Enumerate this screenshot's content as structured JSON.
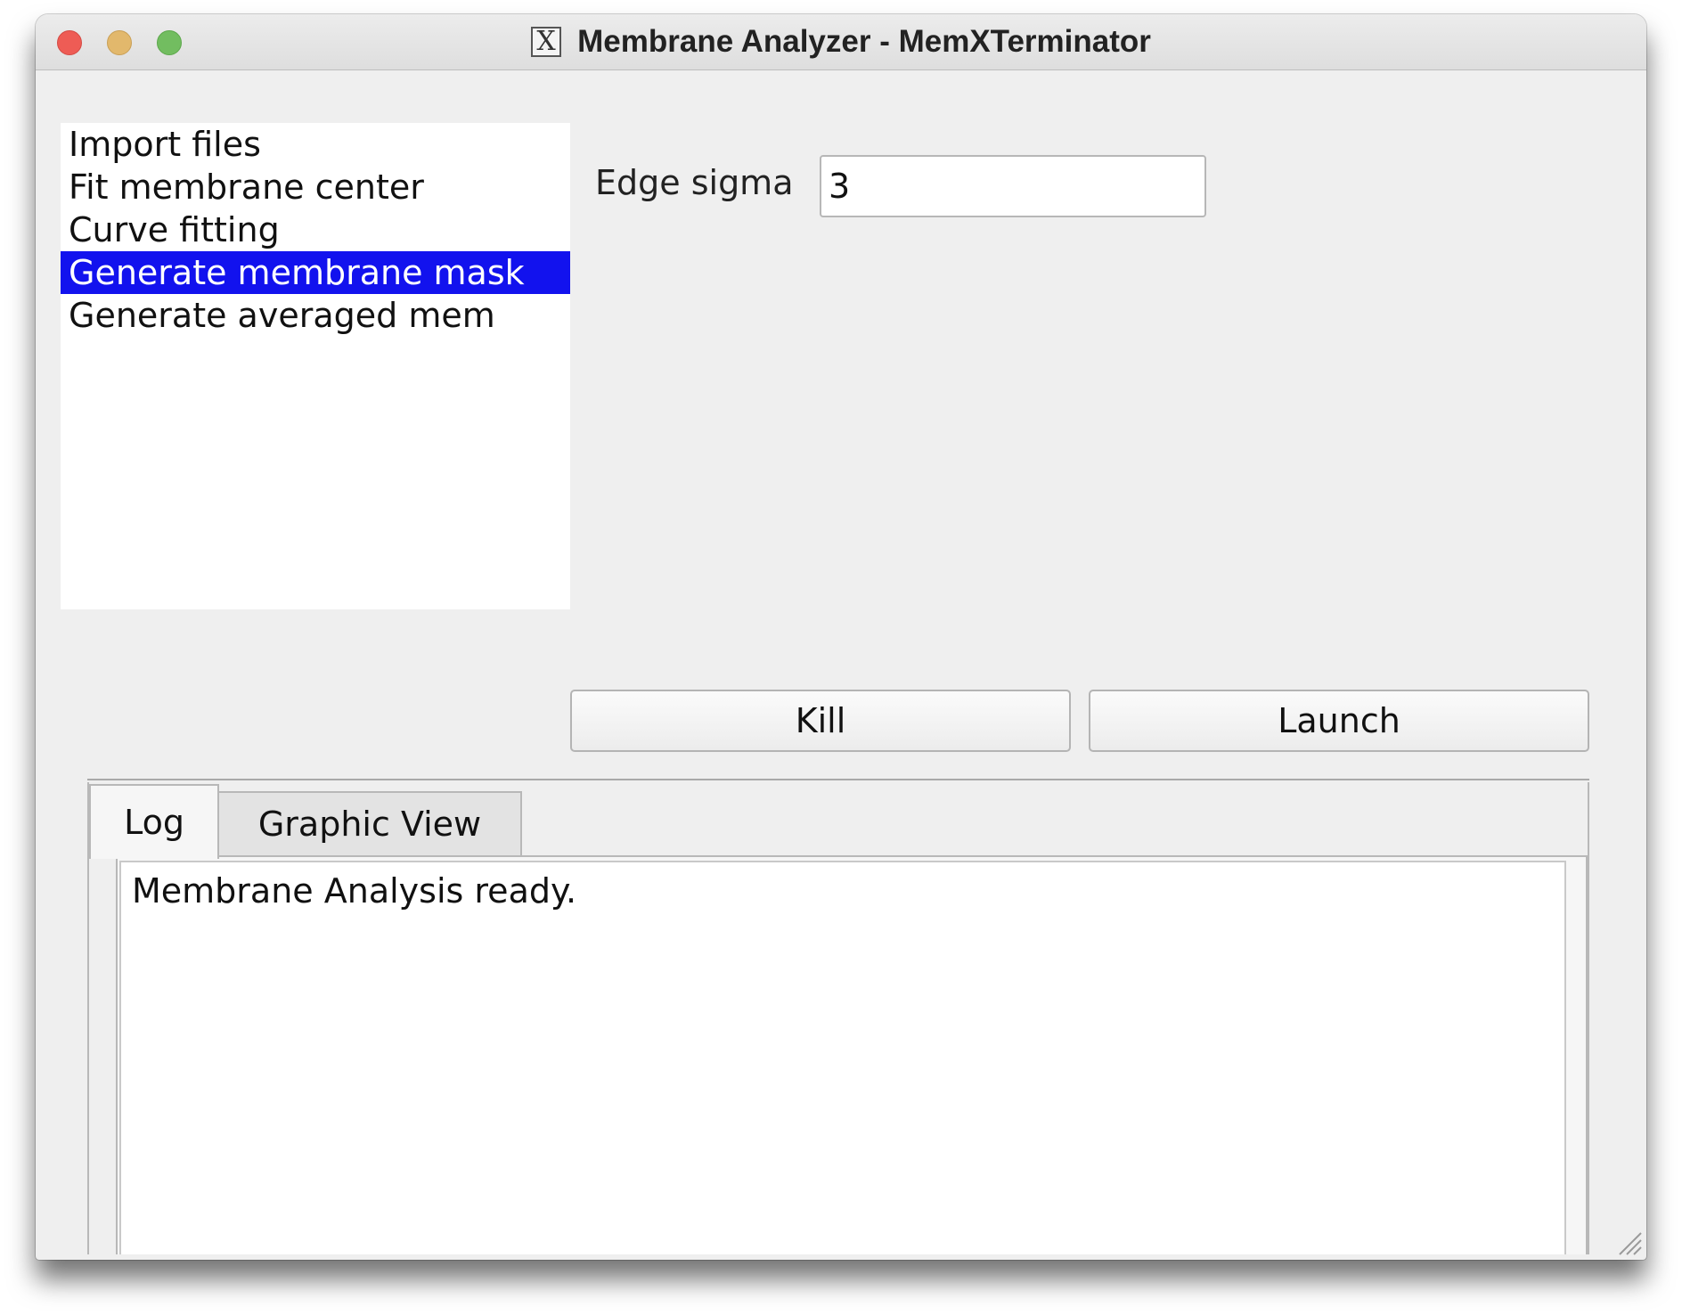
{
  "window": {
    "title": "Membrane Analyzer - MemXTerminator",
    "x_icon_glyph": "X"
  },
  "steps": {
    "items": [
      {
        "label": "Import files",
        "selected": false
      },
      {
        "label": "Fit membrane center",
        "selected": false
      },
      {
        "label": "Curve fitting",
        "selected": false
      },
      {
        "label": "Generate membrane mask",
        "selected": true
      },
      {
        "label": "Generate averaged mem",
        "selected": false
      }
    ]
  },
  "params": {
    "edge_sigma_label": "Edge sigma",
    "edge_sigma_value": "3"
  },
  "buttons": {
    "kill_label": "Kill",
    "launch_label": "Launch"
  },
  "tabs": {
    "items": [
      {
        "label": "Log",
        "active": true
      },
      {
        "label": "Graphic View",
        "active": false
      }
    ]
  },
  "log": {
    "text": "Membrane Analysis ready."
  },
  "colors": {
    "selection": "#1212ee",
    "window_bg": "#efefef",
    "close": "#ee5c55",
    "minimize": "#e2b86c",
    "maximize": "#72bd60"
  }
}
